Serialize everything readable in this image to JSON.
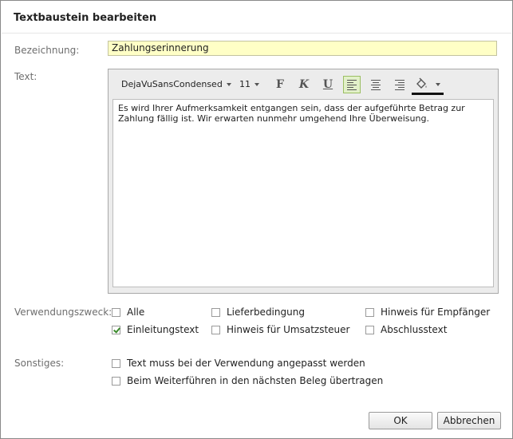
{
  "dialog": {
    "title": "Textbaustein bearbeiten"
  },
  "fields": {
    "name_label": "Bezeichnung:",
    "name_value": "Zahlungserinnerung",
    "text_label": "Text:"
  },
  "toolbar": {
    "font_family": "DejaVuSansCondensed",
    "font_size": "11",
    "bold": "F",
    "italic": "K",
    "underline": "U",
    "active_alignment": "left",
    "fill_color": "#000000"
  },
  "editor": {
    "content": "Es wird Ihrer Aufmerksamkeit entgangen sein, dass der aufgeführte Betrag zur Zahlung fällig ist. Wir erwarten nunmehr umgehend Ihre Überweisung."
  },
  "usage": {
    "label": "Verwendungszweck:",
    "options": [
      {
        "label": "Alle",
        "checked": false
      },
      {
        "label": "Lieferbedingung",
        "checked": false
      },
      {
        "label": "Hinweis für Empfänger",
        "checked": false
      },
      {
        "label": "Einleitungstext",
        "checked": true
      },
      {
        "label": "Hinweis für Umsatzsteuer",
        "checked": false
      },
      {
        "label": "Abschlusstext",
        "checked": false
      }
    ]
  },
  "misc": {
    "label": "Sonstiges:",
    "options": [
      {
        "label": "Text muss bei der Verwendung angepasst werden",
        "checked": false
      },
      {
        "label": "Beim Weiterführen in den nächsten Beleg übertragen",
        "checked": false
      }
    ]
  },
  "buttons": {
    "ok": "OK",
    "cancel": "Abbrechen"
  }
}
